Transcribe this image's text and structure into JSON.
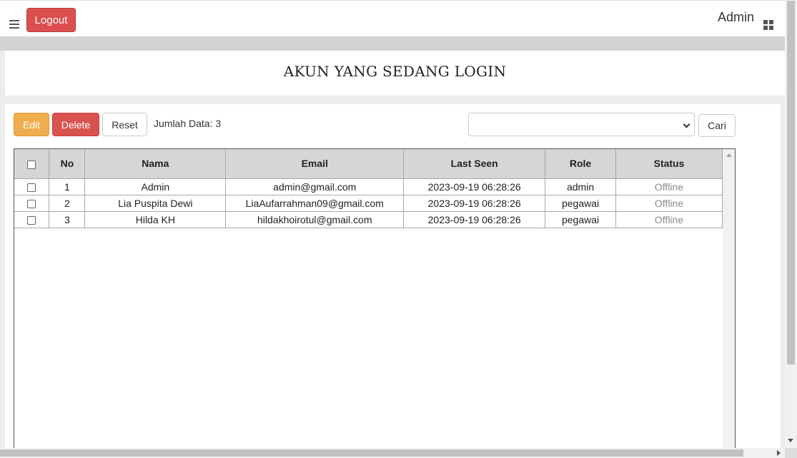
{
  "header": {
    "logout_label": "Logout",
    "user_name": "Admin"
  },
  "page": {
    "title": "AKUN YANG SEDANG LOGIN"
  },
  "toolbar": {
    "edit_label": "Edit",
    "delete_label": "Delete",
    "reset_label": "Reset",
    "count_text": "Jumlah Data: 3",
    "search_value": "",
    "search_label": "Cari"
  },
  "table": {
    "columns": [
      "No",
      "Nama",
      "Email",
      "Last Seen",
      "Role",
      "Status"
    ],
    "rows": [
      {
        "no": "1",
        "nama": "Admin",
        "email": "admin@gmail.com",
        "last_seen": "2023-09-19 06:28:26",
        "role": "admin",
        "status": "Offline"
      },
      {
        "no": "2",
        "nama": "Lia Puspita Dewi",
        "email": "LiaAufarrahman09@gmail.com",
        "last_seen": "2023-09-19 06:28:26",
        "role": "pegawai",
        "status": "Offline"
      },
      {
        "no": "3",
        "nama": "Hilda KH",
        "email": "hildakhoirotul@gmail.com",
        "last_seen": "2023-09-19 06:28:26",
        "role": "pegawai",
        "status": "Offline"
      }
    ]
  },
  "icons": {
    "menu": "hamburger-icon",
    "apps": "grid-icon"
  },
  "colors": {
    "danger": "#d9534f",
    "warning": "#f0ad4e",
    "header_bg": "#d6d6d8"
  }
}
